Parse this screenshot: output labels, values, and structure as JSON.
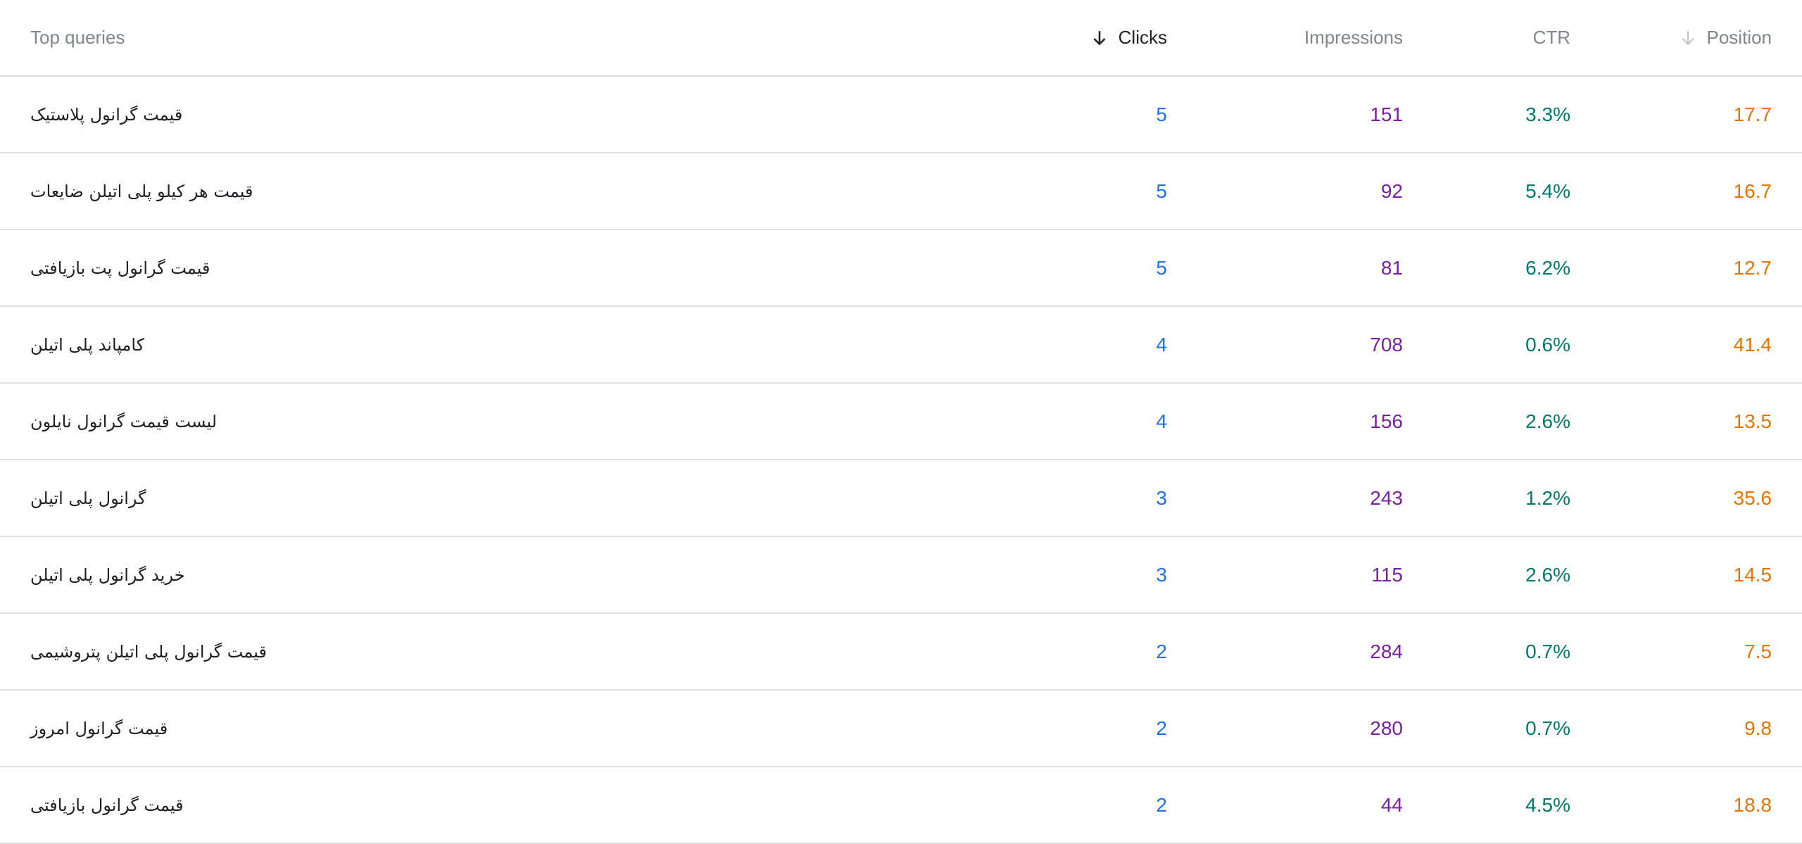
{
  "header": {
    "query_label": "Top queries",
    "clicks_label": "Clicks",
    "impressions_label": "Impressions",
    "ctr_label": "CTR",
    "position_label": "Position",
    "sort_icon_clicks": "arrow-down-icon",
    "sort_icon_position": "arrow-down-icon"
  },
  "colors": {
    "clicks": "#1a73e8",
    "impressions": "#7b1fa2",
    "ctr": "#00796b",
    "position": "#e37400"
  },
  "rows": [
    {
      "query": "قیمت گرانول پلاستیک",
      "clicks": "5",
      "impressions": "151",
      "ctr": "3.3%",
      "position": "17.7"
    },
    {
      "query": "قیمت هر کیلو پلی اتیلن ضایعات",
      "clicks": "5",
      "impressions": "92",
      "ctr": "5.4%",
      "position": "16.7"
    },
    {
      "query": "قیمت گرانول پت بازیافتی",
      "clicks": "5",
      "impressions": "81",
      "ctr": "6.2%",
      "position": "12.7"
    },
    {
      "query": "کامپاند پلی اتیلن",
      "clicks": "4",
      "impressions": "708",
      "ctr": "0.6%",
      "position": "41.4"
    },
    {
      "query": "لیست قیمت گرانول نایلون",
      "clicks": "4",
      "impressions": "156",
      "ctr": "2.6%",
      "position": "13.5"
    },
    {
      "query": "گرانول پلی اتیلن",
      "clicks": "3",
      "impressions": "243",
      "ctr": "1.2%",
      "position": "35.6"
    },
    {
      "query": "خرید گرانول پلی اتیلن",
      "clicks": "3",
      "impressions": "115",
      "ctr": "2.6%",
      "position": "14.5"
    },
    {
      "query": "قیمت گرانول پلی اتیلن پتروشیمی",
      "clicks": "2",
      "impressions": "284",
      "ctr": "0.7%",
      "position": "7.5"
    },
    {
      "query": "قیمت گرانول امروز",
      "clicks": "2",
      "impressions": "280",
      "ctr": "0.7%",
      "position": "9.8"
    },
    {
      "query": "قیمت گرانول بازیافتی",
      "clicks": "2",
      "impressions": "44",
      "ctr": "4.5%",
      "position": "18.8"
    }
  ]
}
